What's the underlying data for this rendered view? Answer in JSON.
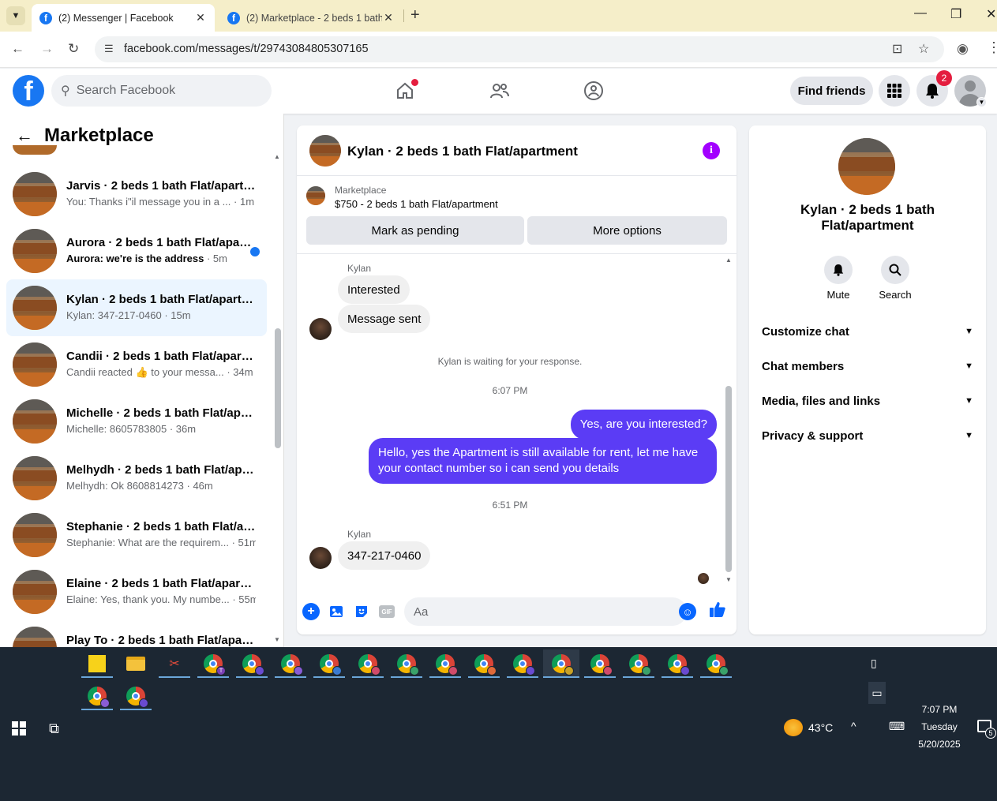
{
  "browser": {
    "tabs": [
      {
        "title": "(2) Messenger | Facebook",
        "close": "✕"
      },
      {
        "title": "(2) Marketplace - 2 beds 1 bath Flat/apartment",
        "close": "✕"
      }
    ],
    "new_tab": "+",
    "url": "facebook.com/messages/t/29743084805307165",
    "window_controls": {
      "minimize": "—",
      "restore": "❐",
      "close": "✕"
    }
  },
  "fb_header": {
    "search_placeholder": "Search Facebook",
    "find_friends": "Find friends",
    "notification_count": "2",
    "logo_letter": "f"
  },
  "left_panel": {
    "title": "Marketplace",
    "threads": [
      {
        "name": "Jarvis · 2 beds 1 bath Flat/apartment",
        "snippet": "You: Thanks i\"il message you in a ...",
        "time": "· 1m",
        "unread": false,
        "active": false
      },
      {
        "name": "Aurora · 2 beds 1 bath Flat/apartment",
        "snippet": "Aurora: we're is the address",
        "time": "· 5m",
        "unread": true,
        "active": false
      },
      {
        "name": "Kylan · 2 beds 1 bath Flat/apartment",
        "snippet": "Kylan: 347-217-0460",
        "time": "· 15m",
        "unread": false,
        "active": true
      },
      {
        "name": "Candii · 2 beds 1 bath Flat/apartment",
        "snippet": "Candii reacted 👍 to your messa...",
        "time": "· 34m",
        "unread": false,
        "active": false
      },
      {
        "name": "Michelle · 2 beds 1 bath Flat/apartment",
        "snippet": "Michelle: 8605783805",
        "time": "· 36m",
        "unread": false,
        "active": false
      },
      {
        "name": "Melhydh · 2 beds 1 bath Flat/apartment",
        "snippet": "Melhydh: Ok 8608814273",
        "time": "· 46m",
        "unread": false,
        "active": false
      },
      {
        "name": "Stephanie · 2 beds 1 bath Flat/apartment",
        "snippet": "Stephanie: What are the requirem...",
        "time": "· 51m",
        "unread": false,
        "active": false
      },
      {
        "name": "Elaine · 2 beds 1 bath Flat/apartment",
        "snippet": "Elaine: Yes, thank you. My numbe...",
        "time": "· 55m",
        "unread": false,
        "active": false
      },
      {
        "name": "Play To · 2 beds 1 bath Flat/apartment",
        "snippet": "",
        "time": "",
        "unread": false,
        "active": false
      }
    ]
  },
  "chat": {
    "title": "Kylan · 2 beds 1 bath Flat/apartment",
    "marketplace_label": "Marketplace",
    "listing": "$750 - 2 beds 1 bath Flat/apartment",
    "mark_pending": "Mark as pending",
    "more_options": "More options",
    "sender_name": "Kylan",
    "msg_interested": "Interested",
    "msg_sent": "Message sent",
    "waiting": "Kylan is waiting for your response.",
    "time1": "6:07 PM",
    "out1": "Yes, are you interested?",
    "out2": "Hello, yes the Apartment is still available for rent, let me have your contact number so i can send you details",
    "time2": "6:51 PM",
    "in_phone": "347-217-0460",
    "composer_placeholder": "Aa"
  },
  "right_panel": {
    "name": "Kylan · 2 beds 1 bath Flat/apartment",
    "mute_label": "Mute",
    "search_label": "Search",
    "sections": [
      "Customize chat",
      "Chat members",
      "Media, files and links",
      "Privacy & support"
    ]
  },
  "taskbar": {
    "temperature": "43°C",
    "time": "7:07 PM",
    "day": "Tuesday",
    "date": "5/20/2025",
    "notification_count": "5"
  },
  "colors": {
    "fb_blue": "#1877f2",
    "outgoing_bubble": "#5b3cf5",
    "info_purple": "#a200ff",
    "tab_bar": "#f5eec9",
    "taskbar": "#1c2733"
  }
}
